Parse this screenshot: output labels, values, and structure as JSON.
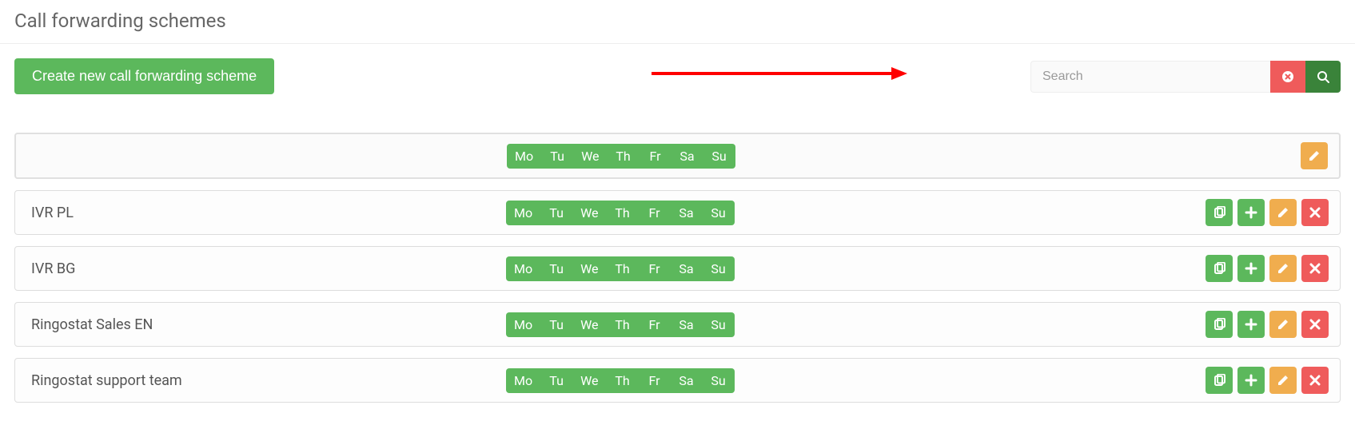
{
  "page": {
    "title": "Call forwarding schemes"
  },
  "toolbar": {
    "create_label": "Create new call forwarding scheme"
  },
  "search": {
    "placeholder": "Search",
    "value": ""
  },
  "days": [
    "Mo",
    "Tu",
    "We",
    "Th",
    "Fr",
    "Sa",
    "Su"
  ],
  "schemes": [
    {
      "name": "",
      "actions": [
        "edit"
      ]
    },
    {
      "name": "IVR PL",
      "actions": [
        "copy",
        "add",
        "edit",
        "delete"
      ]
    },
    {
      "name": "IVR BG",
      "actions": [
        "copy",
        "add",
        "edit",
        "delete"
      ]
    },
    {
      "name": "Ringostat Sales EN",
      "actions": [
        "copy",
        "add",
        "edit",
        "delete"
      ]
    },
    {
      "name": "Ringostat support team",
      "actions": [
        "copy",
        "add",
        "edit",
        "delete"
      ]
    }
  ],
  "colors": {
    "green": "#5cb85c",
    "dark_green": "#3a833a",
    "orange": "#f0ad4e",
    "red": "#ef5b5b"
  }
}
